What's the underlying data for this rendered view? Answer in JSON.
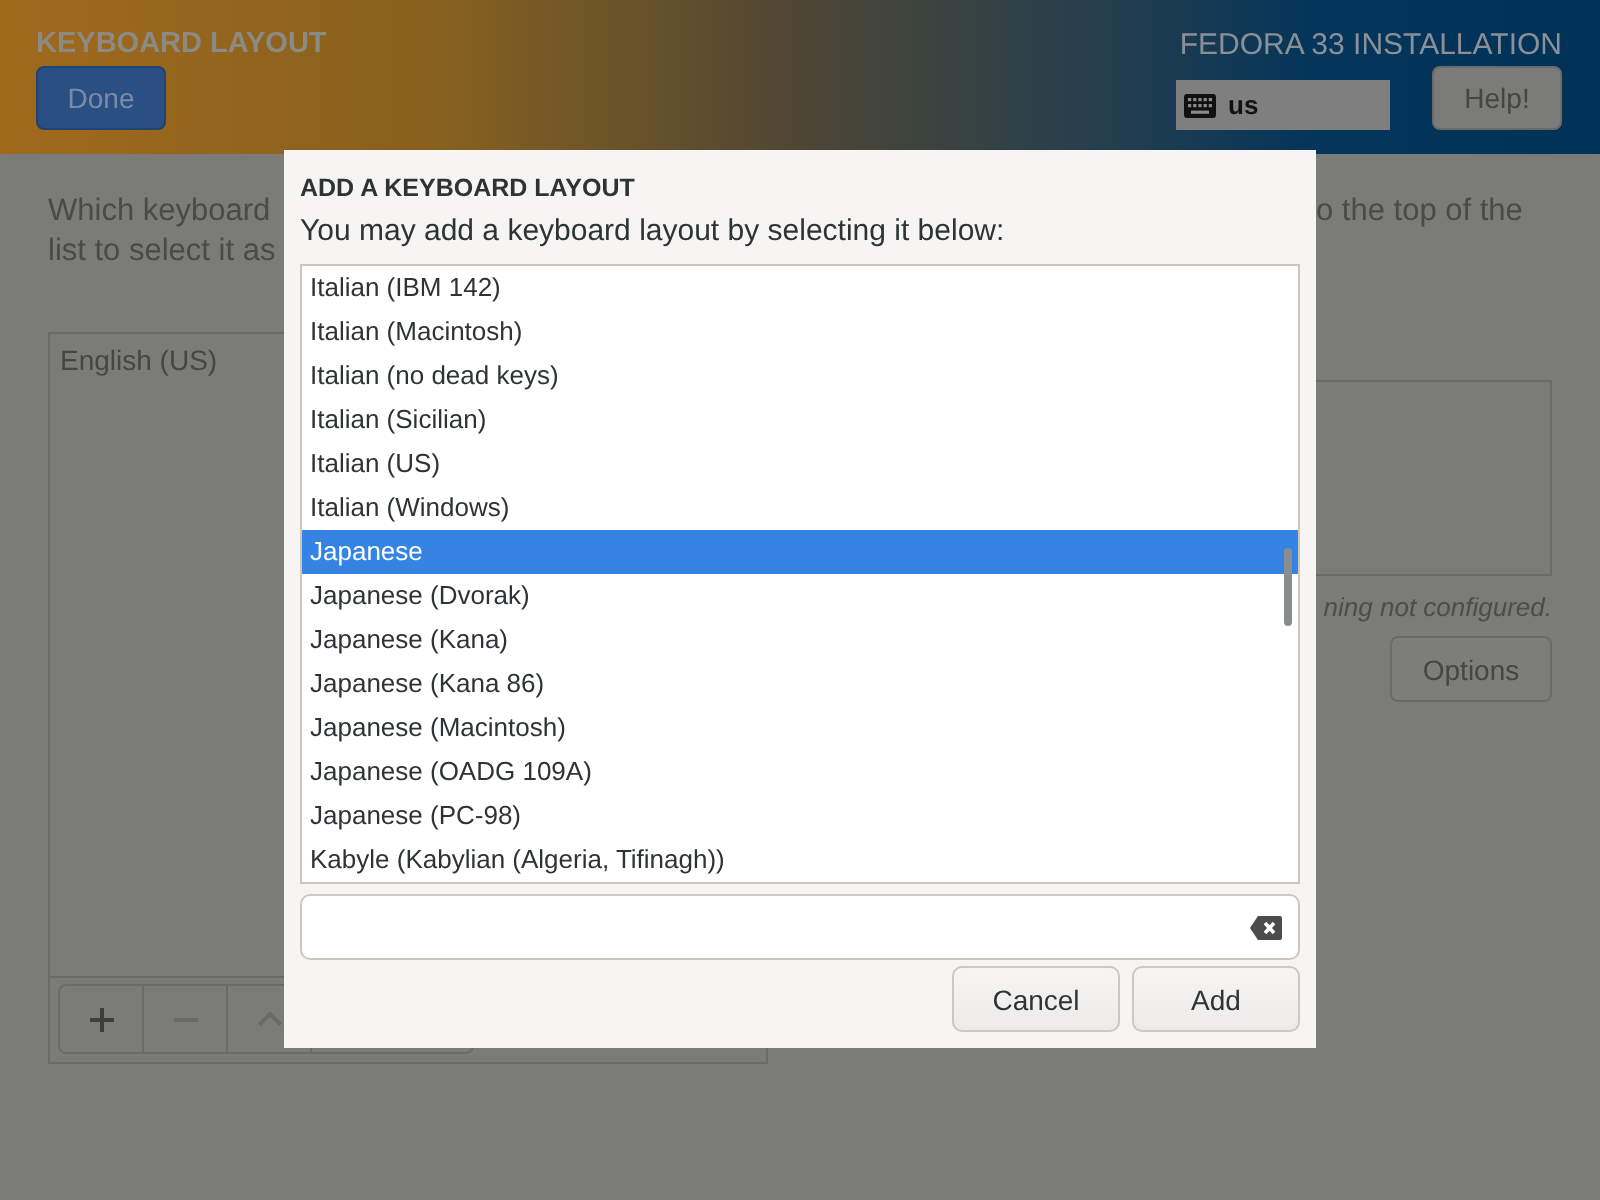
{
  "header": {
    "title": "KEYBOARD LAYOUT",
    "done_button": "Done",
    "product": "FEDORA 33 INSTALLATION",
    "keyboard_layout": "us",
    "help_button": "Help!"
  },
  "intro": {
    "left_lines": [
      "Which keyboard",
      "list to select it as"
    ],
    "right_fragment": "o the top of the"
  },
  "layouts": {
    "items": [
      {
        "label": "English (US)",
        "selected": false
      }
    ],
    "toolbar": [
      {
        "kind": "add",
        "disabled": false
      },
      {
        "kind": "remove",
        "disabled": true
      },
      {
        "kind": "move-up",
        "disabled": true
      }
    ]
  },
  "switching": {
    "status": "ning not configured.",
    "options_button": "Options"
  },
  "dialog": {
    "title": "ADD A KEYBOARD LAYOUT",
    "subtitle": "You may add a keyboard layout by selecting it below:",
    "layouts": [
      {
        "label": "Italian (IBM 142)",
        "selected": false
      },
      {
        "label": "Italian (Macintosh)",
        "selected": false
      },
      {
        "label": "Italian (no dead keys)",
        "selected": false
      },
      {
        "label": "Italian (Sicilian)",
        "selected": false
      },
      {
        "label": "Italian (US)",
        "selected": false
      },
      {
        "label": "Italian (Windows)",
        "selected": false
      },
      {
        "label": "Japanese",
        "selected": true
      },
      {
        "label": "Japanese (Dvorak)",
        "selected": false
      },
      {
        "label": "Japanese (Kana)",
        "selected": false
      },
      {
        "label": "Japanese (Kana 86)",
        "selected": false
      },
      {
        "label": "Japanese (Macintosh)",
        "selected": false
      },
      {
        "label": "Japanese (OADG 109A)",
        "selected": false
      },
      {
        "label": "Japanese (PC-98)",
        "selected": false
      },
      {
        "label": "Kabyle (Kabylian (Algeria, Tifinagh))",
        "selected": false
      }
    ],
    "buttons": [
      {
        "label": "Cancel"
      },
      {
        "label": "Add"
      }
    ]
  }
}
